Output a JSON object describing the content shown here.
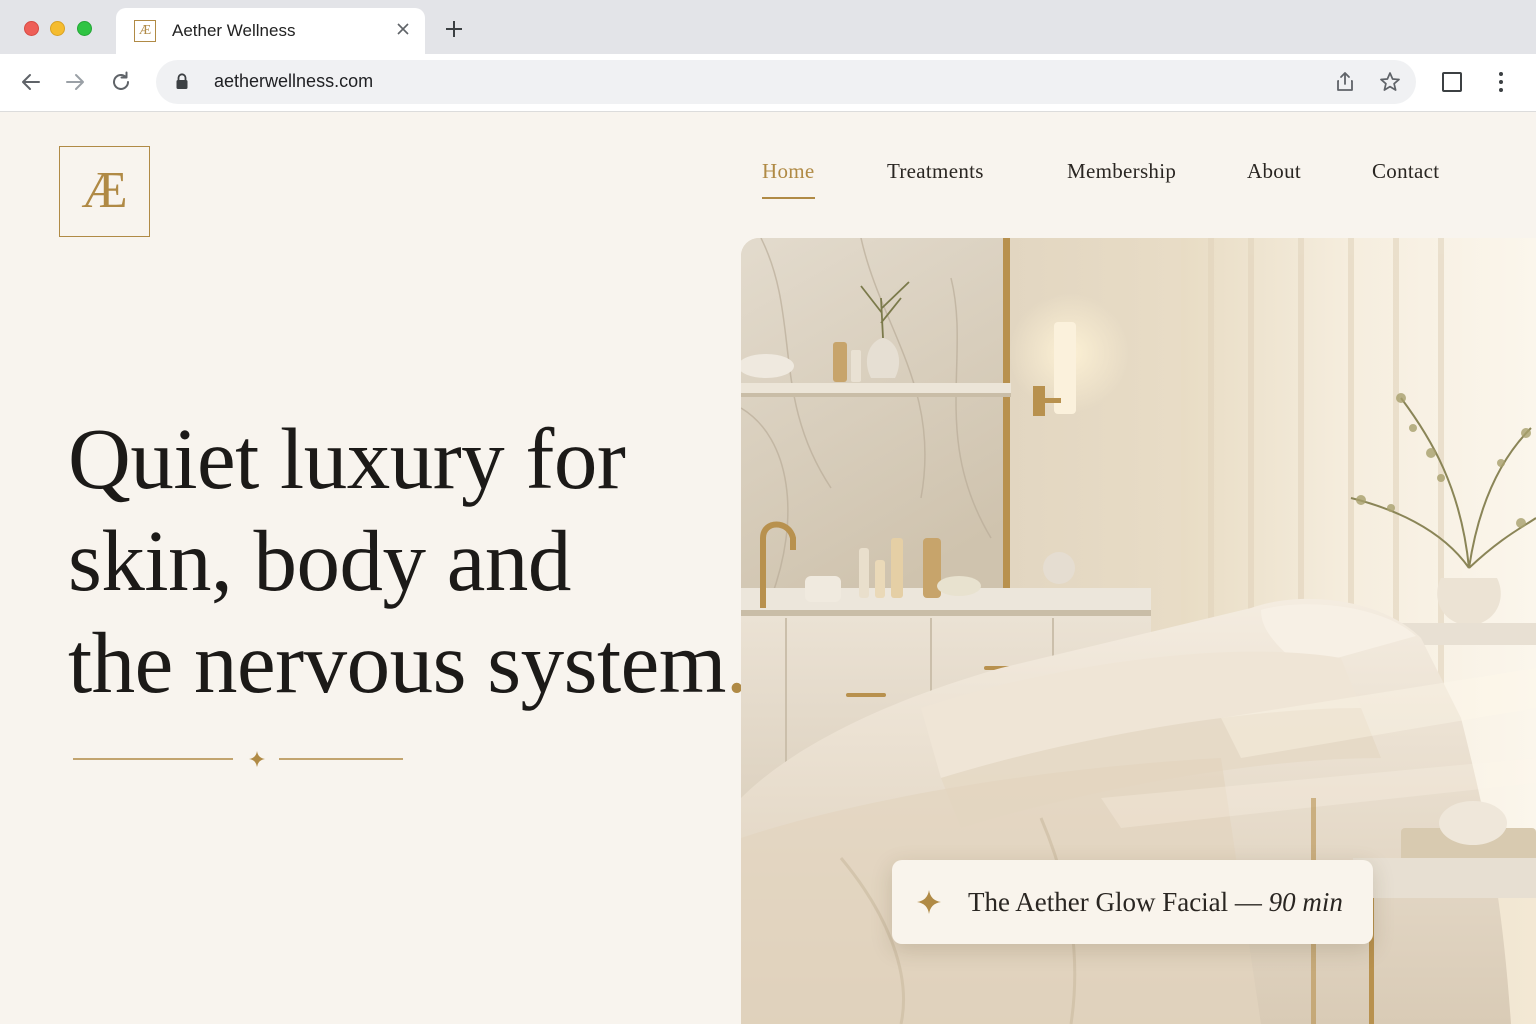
{
  "browser": {
    "tab_title": "Aether Wellness",
    "tab_favicon_text": "Æ",
    "url": "aetherwellness.com"
  },
  "site": {
    "logo_text": "Æ",
    "nav": [
      {
        "label": "Home",
        "active": true
      },
      {
        "label": "Treatments",
        "active": false
      },
      {
        "label": "Membership",
        "active": false
      },
      {
        "label": "About",
        "active": false
      },
      {
        "label": "Contact",
        "active": false
      }
    ],
    "headline_lines": [
      "Quiet luxury for",
      "skin, body and",
      "the nervous system"
    ],
    "headline_end": ".",
    "caption": {
      "title": "The Aether Glow Facial —",
      "duration": "90 min"
    }
  },
  "colors": {
    "accent_gold": "#b08a45",
    "page_background": "#f8f4ee",
    "text_dark": "#1c1a18"
  },
  "icons": [
    "back-arrow-icon",
    "forward-arrow-icon",
    "reload-icon",
    "lock-icon",
    "share-icon",
    "star-icon",
    "sidebar-icon",
    "kebab-menu-icon",
    "sparkle-icon"
  ]
}
